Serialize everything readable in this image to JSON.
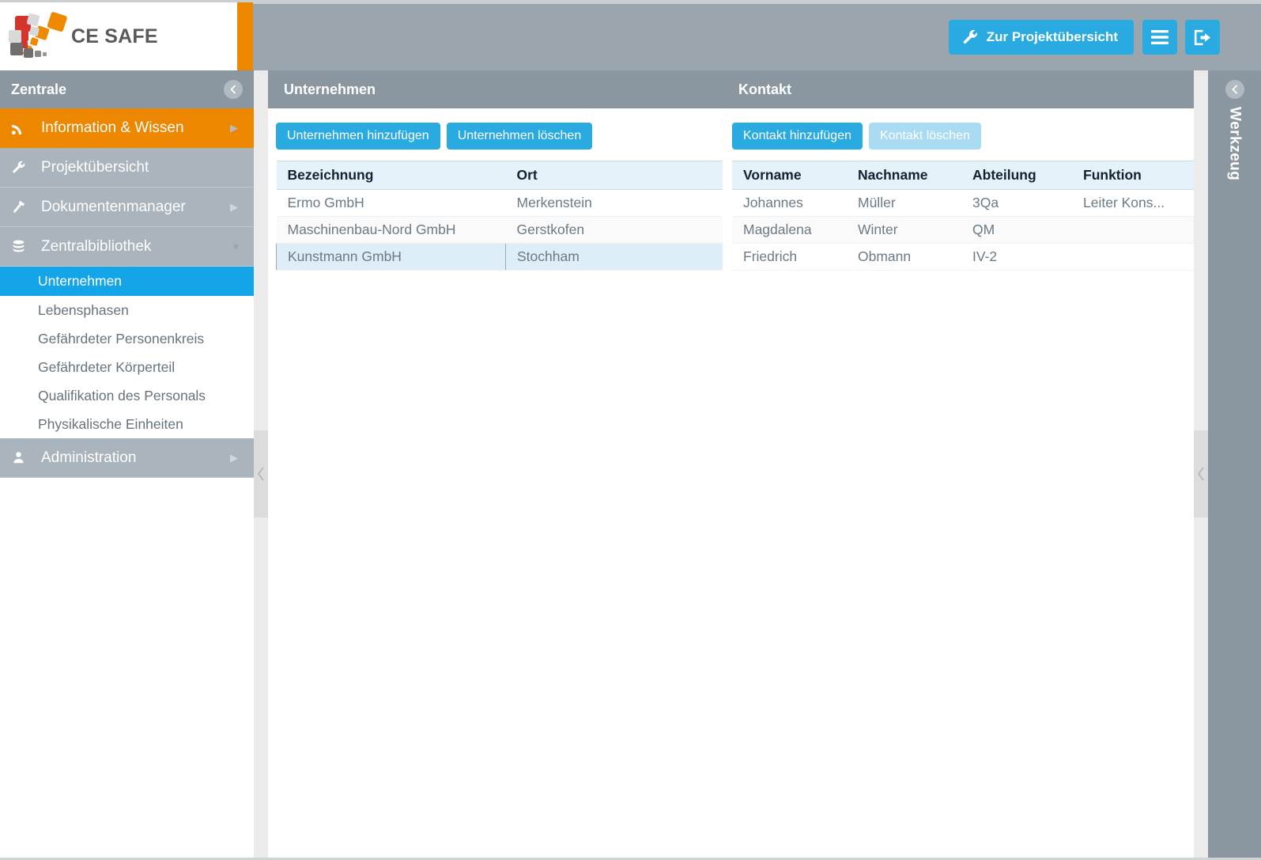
{
  "app": {
    "brand": "CE SAFE",
    "brand_accent_color": "#ee8700",
    "primary_color": "#29abe2",
    "panel_header_color": "#8b97a0"
  },
  "topbar": {
    "project_button": "Zur Projektübersicht",
    "project_icon": "wrench-icon",
    "menu_icon": "hamburger-menu-icon",
    "logout_icon": "logout-icon"
  },
  "sidebar": {
    "title": "Zentrale",
    "collapse_icon": "chevron-left-circle-icon",
    "items": [
      {
        "label": "Information & Wissen",
        "icon": "rss-signal-icon",
        "state": "active-orange",
        "has_arrow": true
      },
      {
        "label": "Projektübersicht",
        "icon": "wrench-icon",
        "state": "grey",
        "has_arrow": false
      },
      {
        "label": "Dokumentenmanager",
        "icon": "hammer-icon",
        "state": "grey",
        "has_arrow": true
      },
      {
        "label": "Zentralbibliothek",
        "icon": "database-icon",
        "state": "grey",
        "has_caret": true
      }
    ],
    "sub_items": [
      {
        "label": "Unternehmen",
        "selected": true
      },
      {
        "label": "Lebensphasen",
        "selected": false
      },
      {
        "label": "Gefährdeter Personenkreis",
        "selected": false
      },
      {
        "label": "Gefährdeter Körperteil",
        "selected": false
      },
      {
        "label": "Qualifikation des Personals",
        "selected": false
      },
      {
        "label": "Physikalische Einheiten",
        "selected": false
      }
    ],
    "bottom_items": [
      {
        "label": "Administration",
        "icon": "user-icon",
        "state": "grey",
        "has_arrow": true
      }
    ]
  },
  "main": {
    "header_left": "Unternehmen",
    "header_right": "Kontakt",
    "companies": {
      "add_button": "Unternehmen hinzufügen",
      "delete_button": "Unternehmen löschen",
      "delete_disabled": false,
      "columns": [
        "Bezeichnung",
        "Ort"
      ],
      "rows": [
        {
          "bezeichnung": "Ermo GmbH",
          "ort": "Merkenstein",
          "selected": false
        },
        {
          "bezeichnung": "Maschinenbau-Nord GmbH",
          "ort": "Gerstkofen",
          "selected": false
        },
        {
          "bezeichnung": "Kunstmann GmbH",
          "ort": "Stochham",
          "selected": true
        }
      ]
    },
    "contacts": {
      "add_button": "Kontakt hinzufügen",
      "delete_button": "Kontakt löschen",
      "delete_disabled": true,
      "columns": [
        "Vorname",
        "Nachname",
        "Abteilung",
        "Funktion"
      ],
      "rows": [
        {
          "vorname": "Johannes",
          "nachname": "Müller",
          "abteilung": "3Qa",
          "funktion": "Leiter Kons..."
        },
        {
          "vorname": "Magdalena",
          "nachname": "Winter",
          "abteilung": "QM",
          "funktion": ""
        },
        {
          "vorname": "Friedrich",
          "nachname": "Obmann",
          "abteilung": "IV-2",
          "funktion": ""
        }
      ]
    }
  },
  "tools": {
    "label": "Werkzeug",
    "collapse_icon": "chevron-left-circle-icon"
  },
  "handles": {
    "left_icon": "chevron-left-icon",
    "right_icon": "chevron-left-icon"
  }
}
